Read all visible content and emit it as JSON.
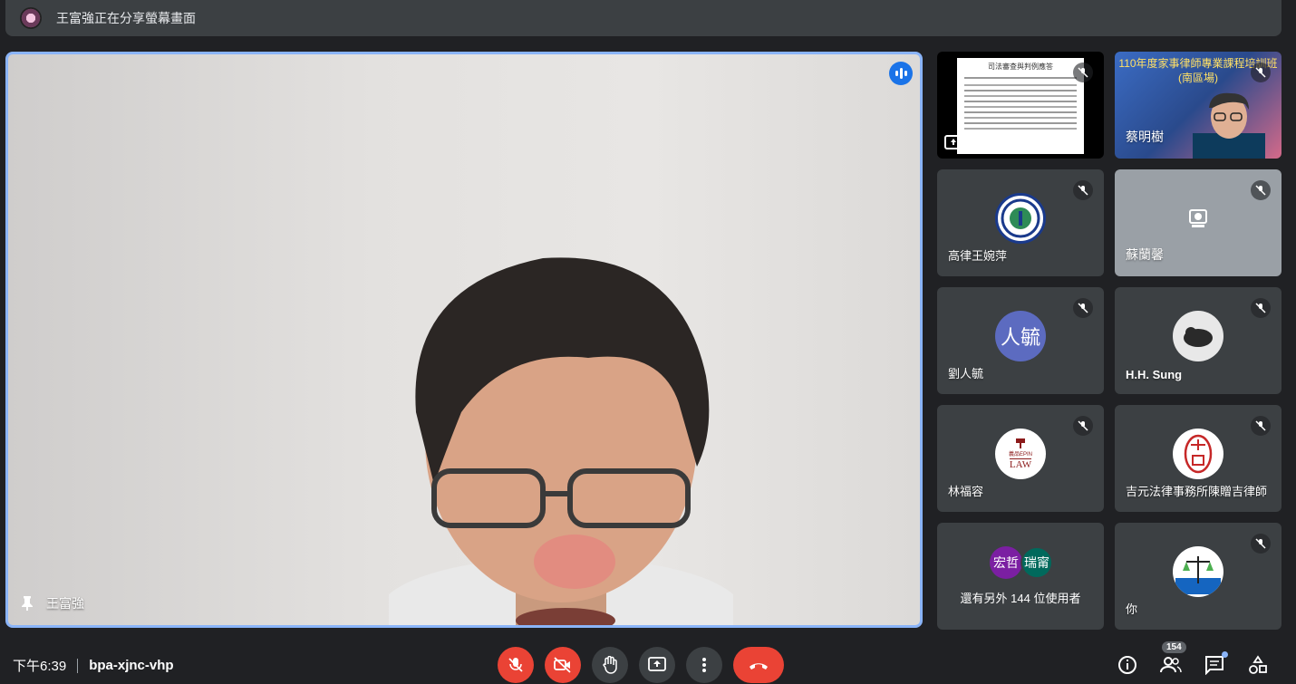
{
  "top_bar": {
    "presenting_text": "王富強正在分享螢幕畫面"
  },
  "main_speaker": {
    "name": "王富強"
  },
  "tiles": [
    {
      "name": "",
      "kind": "screen-share",
      "slide_title": "司法審查與判例應答"
    },
    {
      "name": "蔡明樹",
      "kind": "video",
      "banner_title": "110年度家事律師專業課程培訓班",
      "banner_subtitle": "(南區場)"
    },
    {
      "name": "高律王婉萍",
      "kind": "logo"
    },
    {
      "name": "蘇蘭馨",
      "kind": "no-video"
    },
    {
      "name": "劉人毓",
      "kind": "initials",
      "initials": "人毓",
      "color": "#5c6bc0"
    },
    {
      "name": "H.H. Sung",
      "kind": "photo"
    },
    {
      "name": "林福容",
      "kind": "logo2",
      "logo_text_top": "義品EPIN",
      "logo_text_bottom": "LAW"
    },
    {
      "name": "吉元法律事務所陳贈吉律師",
      "kind": "seal"
    },
    {
      "name": "還有另外 144 位使用者",
      "kind": "others",
      "avatar1": "宏哲",
      "avatar2": "瑞甯"
    },
    {
      "name": "你",
      "kind": "logo3"
    }
  ],
  "bottom_bar": {
    "time": "下午6:39",
    "meeting_code": "bpa-xjnc-vhp",
    "participants_count": "154"
  },
  "colors": {
    "accent": "#8ab4f8",
    "danger": "#ea4335",
    "tile_bg": "#3c4043",
    "bg": "#202124"
  }
}
